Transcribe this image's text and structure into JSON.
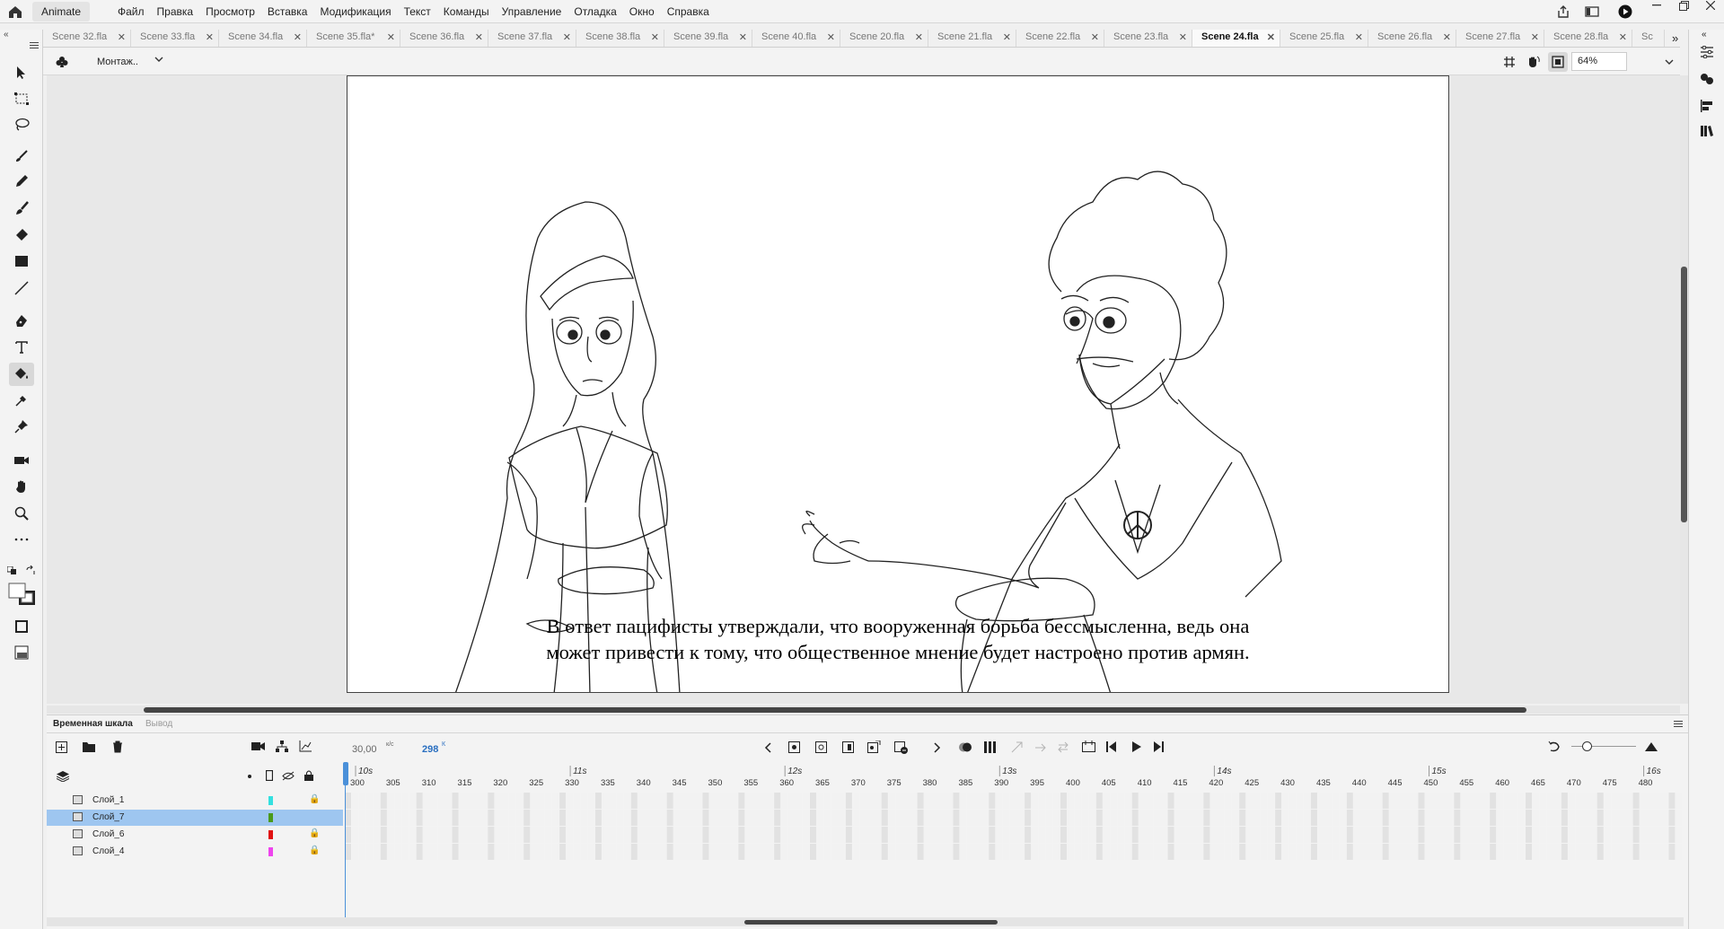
{
  "app": {
    "name": "Animate"
  },
  "menu": [
    "Файл",
    "Правка",
    "Просмотр",
    "Вставка",
    "Модификация",
    "Текст",
    "Команды",
    "Управление",
    "Отладка",
    "Окно",
    "Справка"
  ],
  "tabs": [
    {
      "label": "Scene 32.fla"
    },
    {
      "label": "Scene 33.fla"
    },
    {
      "label": "Scene 34.fla"
    },
    {
      "label": "Scene 35.fla*"
    },
    {
      "label": "Scene 36.fla"
    },
    {
      "label": "Scene 37.fla"
    },
    {
      "label": "Scene 38.fla"
    },
    {
      "label": "Scene 39.fla"
    },
    {
      "label": "Scene 40.fla"
    },
    {
      "label": "Scene 20.fla"
    },
    {
      "label": "Scene 21.fla"
    },
    {
      "label": "Scene 22.fla"
    },
    {
      "label": "Scene 23.fla"
    },
    {
      "label": "Scene 24.fla",
      "active": true
    },
    {
      "label": "Scene 25.fla"
    },
    {
      "label": "Scene 26.fla"
    },
    {
      "label": "Scene 27.fla"
    },
    {
      "label": "Scene 28.fla"
    },
    {
      "label": "Sc"
    }
  ],
  "editbar": {
    "scene_label": "Монтаж..",
    "zoom": "64%"
  },
  "stage": {
    "caption_line1": "В ответ пацифисты утверждали, что вооруженная борьба бессмысленна, ведь она",
    "caption_line2": "может привести к тому, что общественное мнение будет настроено против армян."
  },
  "timeline": {
    "tab_timeline": "Временная шкала",
    "tab_output": "Вывод",
    "fps": "30,00",
    "fps_unit": "к/с",
    "current_frame": "298",
    "current_frame_unit": "К",
    "seconds": [
      "10s",
      "11s",
      "12s",
      "13s",
      "14s",
      "15s",
      "16s"
    ],
    "frame_ticks": [
      "300",
      "305",
      "310",
      "315",
      "320",
      "325",
      "330",
      "335",
      "340",
      "345",
      "350",
      "355",
      "360",
      "365",
      "370",
      "375",
      "380",
      "385",
      "390",
      "395",
      "400",
      "405",
      "410",
      "415",
      "420",
      "425",
      "430",
      "435",
      "440",
      "445",
      "450",
      "455",
      "460",
      "465",
      "470",
      "475",
      "480"
    ],
    "layers": [
      {
        "name": "Слой_1",
        "color": "#33e0e0",
        "locked": true,
        "selected": false
      },
      {
        "name": "Слой_7",
        "color": "#4a9a1a",
        "locked": false,
        "selected": true
      },
      {
        "name": "Слой_6",
        "color": "#e01010",
        "locked": true,
        "selected": false
      },
      {
        "name": "Слой_4",
        "color": "#ee44ee",
        "locked": true,
        "selected": false
      }
    ]
  },
  "colors": {
    "selection": "#9ec6f0",
    "playhead": "#4a90d9",
    "frame_label": "#2a6fc0"
  }
}
